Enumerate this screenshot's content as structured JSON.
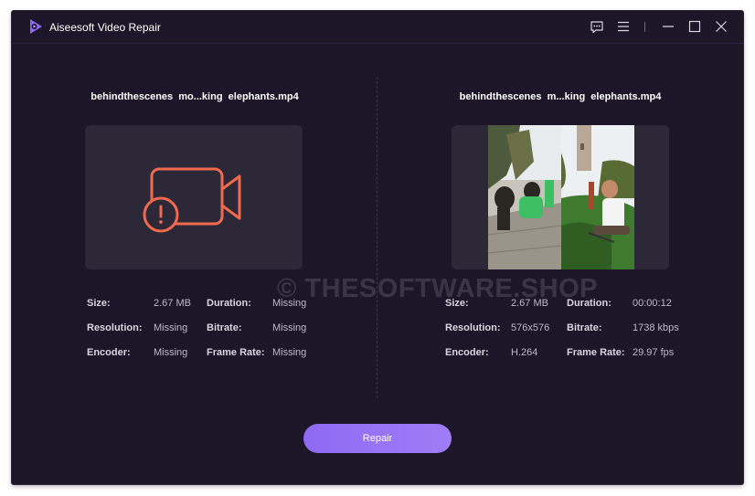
{
  "app": {
    "title": "Aiseesoft Video Repair"
  },
  "titlebar": {
    "icons": [
      "feedback-icon",
      "menu-icon",
      "minimize-icon",
      "maximize-icon",
      "close-icon"
    ]
  },
  "left_panel": {
    "file_name": "behindthescenes  mo...king  elephants.mp4",
    "preview_icon": "broken-video-icon",
    "info": {
      "size_label": "Size:",
      "size_value": "2.67 MB",
      "duration_label": "Duration:",
      "duration_value": "Missing",
      "resolution_label": "Resolution:",
      "resolution_value": "Missing",
      "bitrate_label": "Bitrate:",
      "bitrate_value": "Missing",
      "encoder_label": "Encoder:",
      "encoder_value": "Missing",
      "framerate_label": "Frame Rate:",
      "framerate_value": "Missing"
    }
  },
  "right_panel": {
    "file_name": "behindthescenes  m...king  elephants.mp4",
    "info": {
      "size_label": "Size:",
      "size_value": "2.67 MB",
      "duration_label": "Duration:",
      "duration_value": "00:00:12",
      "resolution_label": "Resolution:",
      "resolution_value": "576x576",
      "bitrate_label": "Bitrate:",
      "bitrate_value": "1738 kbps",
      "encoder_label": "Encoder:",
      "encoder_value": "H.264",
      "framerate_label": "Frame Rate:",
      "framerate_value": "29.97 fps"
    }
  },
  "watermark": "© THESOFTWARE.SHOP",
  "repair_button": "Repair",
  "colors": {
    "background": "#1c1628",
    "panel": "#2d2838",
    "accent": "#9474f5",
    "error_icon": "#f06a4e"
  }
}
